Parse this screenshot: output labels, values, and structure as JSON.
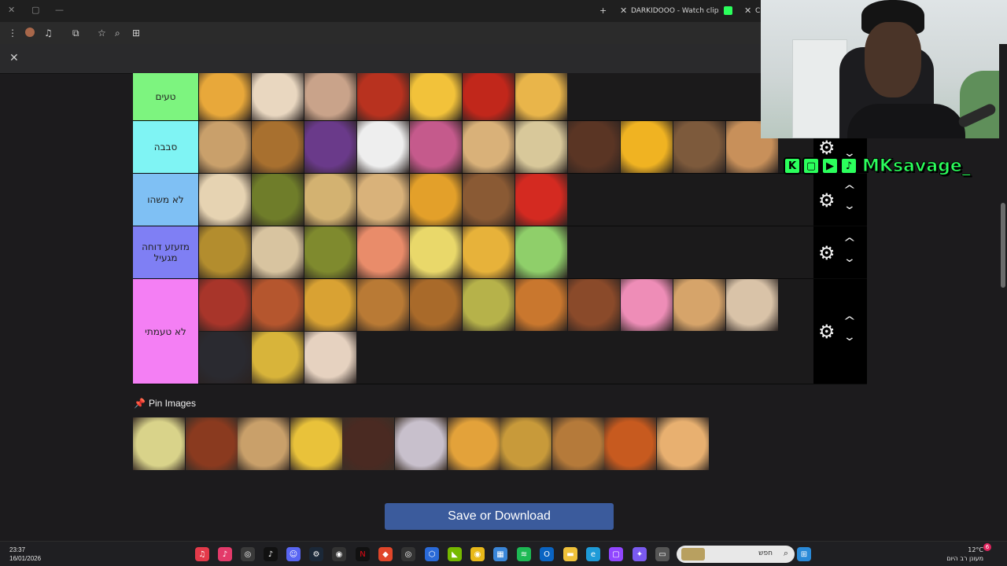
{
  "browser": {
    "tab_active_label": "DARKIDOOO - Watch clips on",
    "tab_partial_label": "C"
  },
  "tiers": [
    {
      "label": "טעים",
      "color": "#7df47f",
      "tiles": [
        {
          "name": "french-fries",
          "color": "#e8a83a"
        },
        {
          "name": "popcorn",
          "color": "#e9d7c0"
        },
        {
          "name": "crepe-strawberry",
          "color": "#c9a38a"
        },
        {
          "name": "shakshuka",
          "color": "#b8321f"
        },
        {
          "name": "fried-egg",
          "color": "#f2c23a"
        },
        {
          "name": "tomato-sauce",
          "color": "#c1271b"
        },
        {
          "name": "omelette",
          "color": "#e9b54a"
        }
      ]
    },
    {
      "label": "סבבה",
      "color": "#7ff4f4",
      "tiles": [
        {
          "name": "samosa-triangles",
          "color": "#c9a06b"
        },
        {
          "name": "croissant",
          "color": "#a8702f"
        },
        {
          "name": "ice-pop",
          "color": "#6a3a8a"
        },
        {
          "name": "white-rice",
          "color": "#eeeeee"
        },
        {
          "name": "colored-popsicles",
          "color": "#c55a8c"
        },
        {
          "name": "bourekas",
          "color": "#d9b179"
        },
        {
          "name": "rice-with-veggies",
          "color": "#d8c89a"
        },
        {
          "name": "chocolate-puffs",
          "color": "#5a3524"
        },
        {
          "name": "mac-and-cheese",
          "color": "#f0b322"
        },
        {
          "name": "fish-dish",
          "color": "#7d5a3c"
        },
        {
          "name": "bagels",
          "color": "#c8905a"
        }
      ]
    },
    {
      "label": "לא משהו",
      "color": "#7fc0f4",
      "tiles": [
        {
          "name": "sandwich",
          "color": "#e6d3b2"
        },
        {
          "name": "pickles",
          "color": "#6f7d2a"
        },
        {
          "name": "hummus",
          "color": "#d3b271"
        },
        {
          "name": "hamantaschen",
          "color": "#d9b27a"
        },
        {
          "name": "honey",
          "color": "#e3a02a"
        },
        {
          "name": "muffin",
          "color": "#8a5a34"
        },
        {
          "name": "stuffed-peppers",
          "color": "#d42a21"
        }
      ]
    },
    {
      "label": "מזעזע דוחה מגעיל",
      "color": "#7f7ff4",
      "tiles": [
        {
          "name": "pea-soup",
          "color": "#b38d2e"
        },
        {
          "name": "matzah",
          "color": "#d8c4a0"
        },
        {
          "name": "olives-peppers",
          "color": "#7f8a2e"
        },
        {
          "name": "sushi",
          "color": "#e98c6a"
        },
        {
          "name": "mashed-potatoes",
          "color": "#e9d86a"
        },
        {
          "name": "corn-cob",
          "color": "#e7b23a"
        },
        {
          "name": "green-salad",
          "color": "#8fcf6a"
        }
      ]
    },
    {
      "label": "לא טעמתי",
      "color": "#f47ff4",
      "tiles": [
        {
          "name": "bacon",
          "color": "#a8352a"
        },
        {
          "name": "lattice-pie",
          "color": "#b5562e"
        },
        {
          "name": "tacos",
          "color": "#d9a233"
        },
        {
          "name": "waffles",
          "color": "#b97a35"
        },
        {
          "name": "cheeseburger",
          "color": "#a96a2a"
        },
        {
          "name": "kadaif",
          "color": "#b6b24a"
        },
        {
          "name": "mozzarella-sticks",
          "color": "#c9772e"
        },
        {
          "name": "latkes",
          "color": "#8a4a2a"
        },
        {
          "name": "pink-donut",
          "color": "#ee8db7"
        },
        {
          "name": "fried-dumplings",
          "color": "#d6a46a"
        },
        {
          "name": "tahini-bowl",
          "color": "#d9c3a8"
        },
        {
          "name": "caviar-crackers",
          "color": "#2a2a30"
        },
        {
          "name": "chicken-soup",
          "color": "#d8b43a"
        },
        {
          "name": "gefilte-fish",
          "color": "#e6d2c0"
        }
      ]
    }
  ],
  "pin": {
    "title": "Pin Images",
    "tiles": [
      {
        "name": "gnocchi",
        "color": "#d9d38a"
      },
      {
        "name": "chicken-wings",
        "color": "#8a3a1f"
      },
      {
        "name": "grilled-chicken",
        "color": "#c9a06a"
      },
      {
        "name": "fruit-salad",
        "color": "#e9c23a"
      },
      {
        "name": "brownies",
        "color": "#4a2a22"
      },
      {
        "name": "parfait",
        "color": "#c8c0cc"
      },
      {
        "name": "grilled-cheese",
        "color": "#e3a23a"
      },
      {
        "name": "cheese-pastry",
        "color": "#c89a3a"
      },
      {
        "name": "quiche",
        "color": "#b57a3a"
      },
      {
        "name": "sweet-potatoes",
        "color": "#c75a1f"
      },
      {
        "name": "toast",
        "color": "#e8b070"
      }
    ]
  },
  "save_button": "Save or Download",
  "stream": {
    "handle": "MKsavage_"
  },
  "taskbar": {
    "time": "23:37",
    "date": "16/01/2026",
    "search_placeholder": "חפש",
    "temperature": "12°C",
    "weather_desc": "מעונן רב היום",
    "notif_count": "6"
  },
  "icons": [
    "close-icon",
    "restore-icon",
    "minimize-icon",
    "new-tab-icon",
    "kick-icon",
    "menu-icon",
    "profile-icon",
    "media-icon",
    "extensions-icon",
    "star-icon",
    "zoom-icon",
    "translate-icon",
    "gear-icon",
    "chevron-up-icon",
    "chevron-down-icon",
    "pin-icon"
  ]
}
